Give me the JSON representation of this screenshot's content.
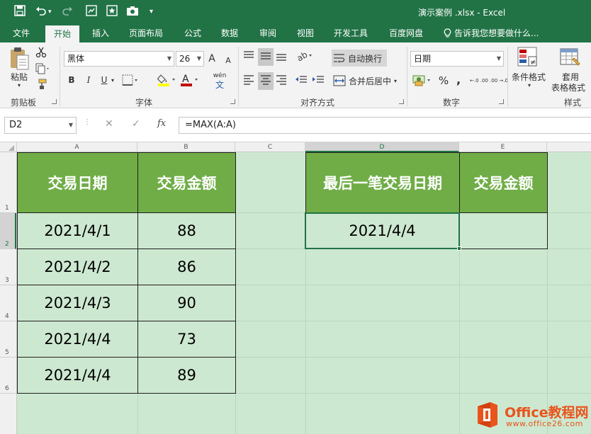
{
  "titlebar": {
    "window_title": "演示案例 .xlsx  -  Excel",
    "qa_save": "💾",
    "qa_undo": "↶",
    "qa_redo": "↷",
    "qa_customize": "▾"
  },
  "tabs": [
    {
      "label": "文件"
    },
    {
      "label": "开始"
    },
    {
      "label": "插入"
    },
    {
      "label": "页面布局"
    },
    {
      "label": "公式"
    },
    {
      "label": "数据"
    },
    {
      "label": "审阅"
    },
    {
      "label": "视图"
    },
    {
      "label": "开发工具"
    },
    {
      "label": "百度网盘"
    },
    {
      "label": "告诉我您想要做什么..."
    }
  ],
  "ribbon": {
    "paste_label": "粘贴",
    "clipboard_label": "剪贴板",
    "font_name": "黑体",
    "font_size": "26",
    "font_group_label": "字体",
    "grow_font": "A",
    "shrink_font": "A",
    "bold": "B",
    "italic": "I",
    "underline": "U",
    "phonetic": "wén",
    "font_color_letter": "A",
    "wrap_text": "自动换行",
    "merge_center": "合并后居中",
    "align_group_label": "对齐方式",
    "number_format": "日期",
    "number_group_label": "数字",
    "percent": "%",
    "comma": ",",
    "inc_decimal": "←.0 .00",
    "dec_decimal": ".00 →.0",
    "cond_format": "条件格式",
    "table_format_1": "套用",
    "table_format_2": "表格格式",
    "styles_group_label": "样式"
  },
  "formula_bar": {
    "name_box": "D2",
    "cancel": "✕",
    "enter": "✓",
    "fx": "fx",
    "formula": "=MAX(A:A)"
  },
  "sheet": {
    "columns": [
      "A",
      "B",
      "C",
      "D",
      "E"
    ],
    "rows": [
      "1",
      "2",
      "3",
      "4",
      "5",
      "6"
    ],
    "table_headers": [
      "交易日期",
      "交易金额"
    ],
    "table_rows": [
      [
        "2021/4/1",
        "88"
      ],
      [
        "2021/4/2",
        "86"
      ],
      [
        "2021/4/3",
        "90"
      ],
      [
        "2021/4/4",
        "73"
      ],
      [
        "2021/4/4",
        "89"
      ]
    ],
    "result_headers": [
      "最后一笔交易日期",
      "交易金额"
    ],
    "result_values": [
      "2021/4/4",
      ""
    ]
  },
  "watermark": {
    "brand": "Office教程网",
    "url": "www.office26.com"
  },
  "colors": {
    "excel_green": "#217346",
    "header_fill": "#70ad47",
    "sheet_bg": "#cde8d0",
    "logo_orange": "#e8541c"
  }
}
